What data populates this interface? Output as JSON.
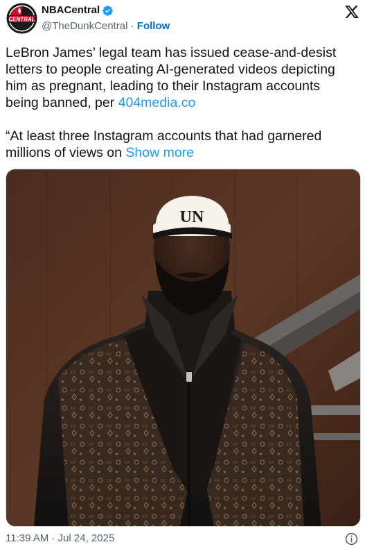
{
  "account": {
    "name": "NBACentral",
    "handle": "@TheDunkCentral",
    "separator": " · ",
    "follow_label": "Follow",
    "avatar_text": "CENTRAL",
    "verified_color": "#1d9bf0"
  },
  "tweet": {
    "text_main": "LeBron James’ legal team has issued cease-and-desist letters to people creating AI-generated videos depicting him as pregnant, leading to their Instagram accounts being banned, per ",
    "text_link": "404media.co",
    "quote_text": "“At least three Instagram accounts that had garnered millions of views on ",
    "show_more_label": "Show more"
  },
  "media": {
    "description_icon": "photo",
    "cap_text": "UN"
  },
  "footer": {
    "timestamp": "11:39 AM · Jul 24, 2025"
  },
  "icons": {
    "platform_logo": "x-logo-icon",
    "info": "info-icon",
    "verified": "verified-badge-icon"
  },
  "colors": {
    "link": "#1d9bf0",
    "follow": "#006fd6",
    "secondary_text": "#536471",
    "primary_text": "#0f1419"
  }
}
